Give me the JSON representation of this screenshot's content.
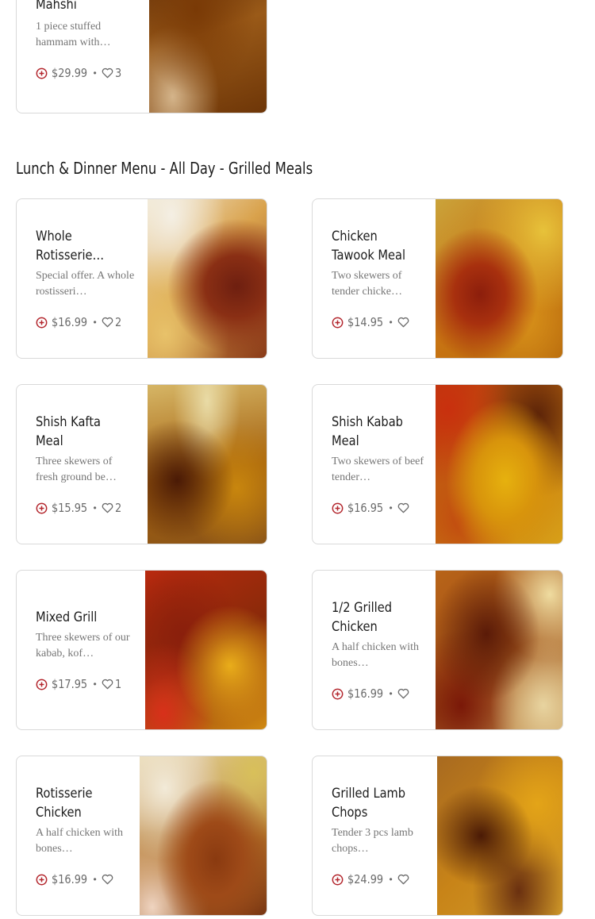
{
  "section": {
    "title": "Lunch & Dinner Menu - All Day - Grilled Meals"
  },
  "items": [
    {
      "name": "Mahshi",
      "description": "1 piece stuffed hammam with…",
      "price": "$29.99",
      "separator": "•",
      "likes": "3",
      "image": "stuffed-hammam-photo"
    },
    {
      "name": "Whole Rotisserie…",
      "description": "Special offer. A whole rostisseri…",
      "price": "$16.99",
      "separator": "•",
      "likes": "2",
      "image": "whole-rotisserie-photo"
    },
    {
      "name": "Chicken Tawook Meal",
      "description": "Two skewers of tender chicke…",
      "price": "$14.95",
      "separator": "•",
      "likes": "",
      "image": "chicken-tawook-photo"
    },
    {
      "name": "Shish Kafta Meal",
      "description": "Three skewers of fresh ground be…",
      "price": "$15.95",
      "separator": "•",
      "likes": "2",
      "image": "shish-kafta-photo"
    },
    {
      "name": "Shish Kabab Meal",
      "description": "Two skewers of beef tender…",
      "price": "$16.95",
      "separator": "•",
      "likes": "",
      "image": "shish-kabab-photo"
    },
    {
      "name": "Mixed Grill",
      "description": "Three skewers of our kabab, kof…",
      "price": "$17.95",
      "separator": "•",
      "likes": "1",
      "image": "mixed-grill-photo"
    },
    {
      "name": "1/2 Grilled Chicken",
      "description": "A half chicken with bones…",
      "price": "$16.99",
      "separator": "•",
      "likes": "",
      "image": "half-grilled-chicken-photo"
    },
    {
      "name": "Rotisserie Chicken",
      "description": "A half chicken with bones…",
      "price": "$16.99",
      "separator": "•",
      "likes": "",
      "image": "rotisserie-chicken-photo"
    },
    {
      "name": "Grilled Lamb Chops",
      "description": "Tender 3 pcs lamb chops…",
      "price": "$24.99",
      "separator": "•",
      "likes": "",
      "image": "grilled-lamb-chops-photo"
    }
  ],
  "colors": {
    "accent": "#b3262d",
    "text_muted": "#767676",
    "border": "#d9d9d9"
  },
  "icons": {
    "add": "plus-circle-icon",
    "like": "heart-outline-icon"
  }
}
